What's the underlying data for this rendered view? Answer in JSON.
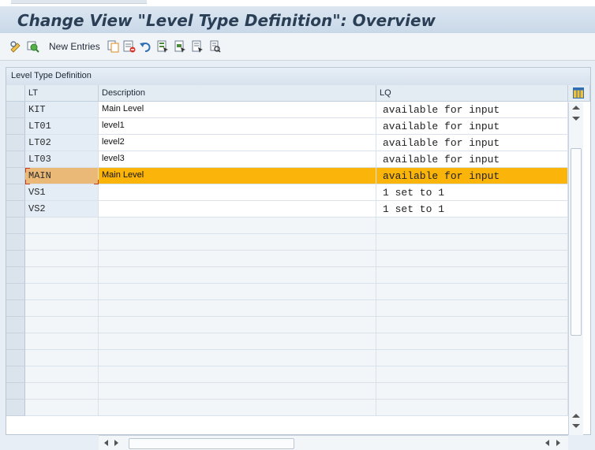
{
  "page": {
    "title": "Change View \"Level Type Definition\": Overview"
  },
  "toolbar": {
    "new_entries_label": "New Entries",
    "icons": [
      "display-change-icon",
      "other-view-icon",
      "copy-icon",
      "delete-icon",
      "undo-icon",
      "select-all-icon",
      "select-block-icon",
      "deselect-all-icon",
      "print-icon"
    ]
  },
  "table": {
    "title": "Level Type Definition",
    "columns": [
      "LT",
      "Description",
      "LQ"
    ],
    "rows": [
      {
        "lt": "KIT",
        "description": "Main Level",
        "lq": "available for input",
        "selected": false
      },
      {
        "lt": "LT01",
        "description": "level1",
        "lq": "available for input",
        "selected": false
      },
      {
        "lt": "LT02",
        "description": "level2",
        "lq": "available for input",
        "selected": false
      },
      {
        "lt": "LT03",
        "description": "level3",
        "lq": "available for input",
        "selected": false
      },
      {
        "lt": "MAIN",
        "description": "Main Level",
        "lq": "available for input",
        "selected": true
      },
      {
        "lt": "VS1",
        "description": "",
        "lq": "1 set to 1",
        "selected": false
      },
      {
        "lt": "VS2",
        "description": "",
        "lq": "1 set to 1",
        "selected": false
      }
    ],
    "empty_rows": 12
  },
  "colors": {
    "selected_row": "#fbb40a",
    "key_column": "#e4edf6",
    "header": "#e3ebf3"
  }
}
